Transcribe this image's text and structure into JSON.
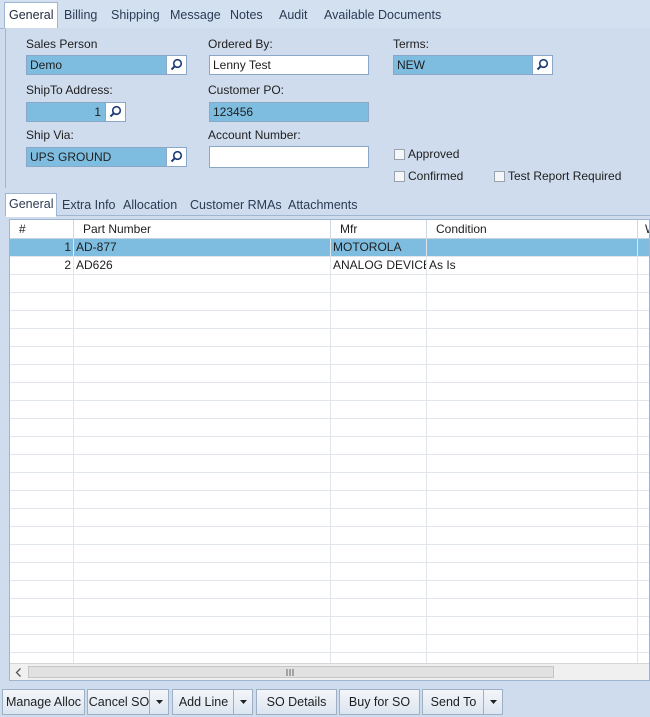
{
  "top_tabs": [
    "General",
    "Billing",
    "Shipping",
    "Message",
    "Notes",
    "Audit",
    "Available Documents"
  ],
  "form": {
    "sales_person": {
      "label": "Sales Person",
      "value": "Demo"
    },
    "ordered_by": {
      "label": "Ordered By:",
      "value": "Lenny Test"
    },
    "terms": {
      "label": "Terms:",
      "value": "NEW"
    },
    "shipto": {
      "label": "ShipTo Address:",
      "value": "1"
    },
    "customer_po": {
      "label": "Customer PO:",
      "value": "123456"
    },
    "ship_via": {
      "label": "Ship Via:",
      "value": "UPS GROUND"
    },
    "account_number": {
      "label": "Account Number:",
      "value": ""
    },
    "approved": {
      "label": "Approved",
      "checked": false
    },
    "confirmed": {
      "label": "Confirmed",
      "checked": false
    },
    "test_report": {
      "label": "Test Report Required",
      "checked": false
    }
  },
  "lower_tabs": [
    "General",
    "Extra Info",
    "Allocation",
    "Customer RMAs",
    "Attachments"
  ],
  "grid": {
    "columns": [
      "#",
      "Part Number",
      "Mfr",
      "Condition",
      "W"
    ],
    "rows": [
      {
        "num": "1",
        "part": "AD-877",
        "mfr": "MOTOROLA",
        "condition": ""
      },
      {
        "num": "2",
        "part": "AD626",
        "mfr": "ANALOG DEVICE",
        "condition": "As Is"
      }
    ]
  },
  "toolbar": {
    "manage_alloc": "Manage Alloc",
    "cancel_so": "Cancel SO",
    "add_line": "Add Line",
    "so_details": "SO Details",
    "buy_for_so": "Buy for SO",
    "send_to": "Send To"
  },
  "icons": {
    "lookup": "magnifier-icon",
    "dropdown": "chevron-down-icon",
    "scroll_left": "chevron-left-icon",
    "grip": "scroll-grip-icon"
  },
  "colors": {
    "selected_field": "#7ebde0",
    "panel_bg": "#cfdced"
  }
}
